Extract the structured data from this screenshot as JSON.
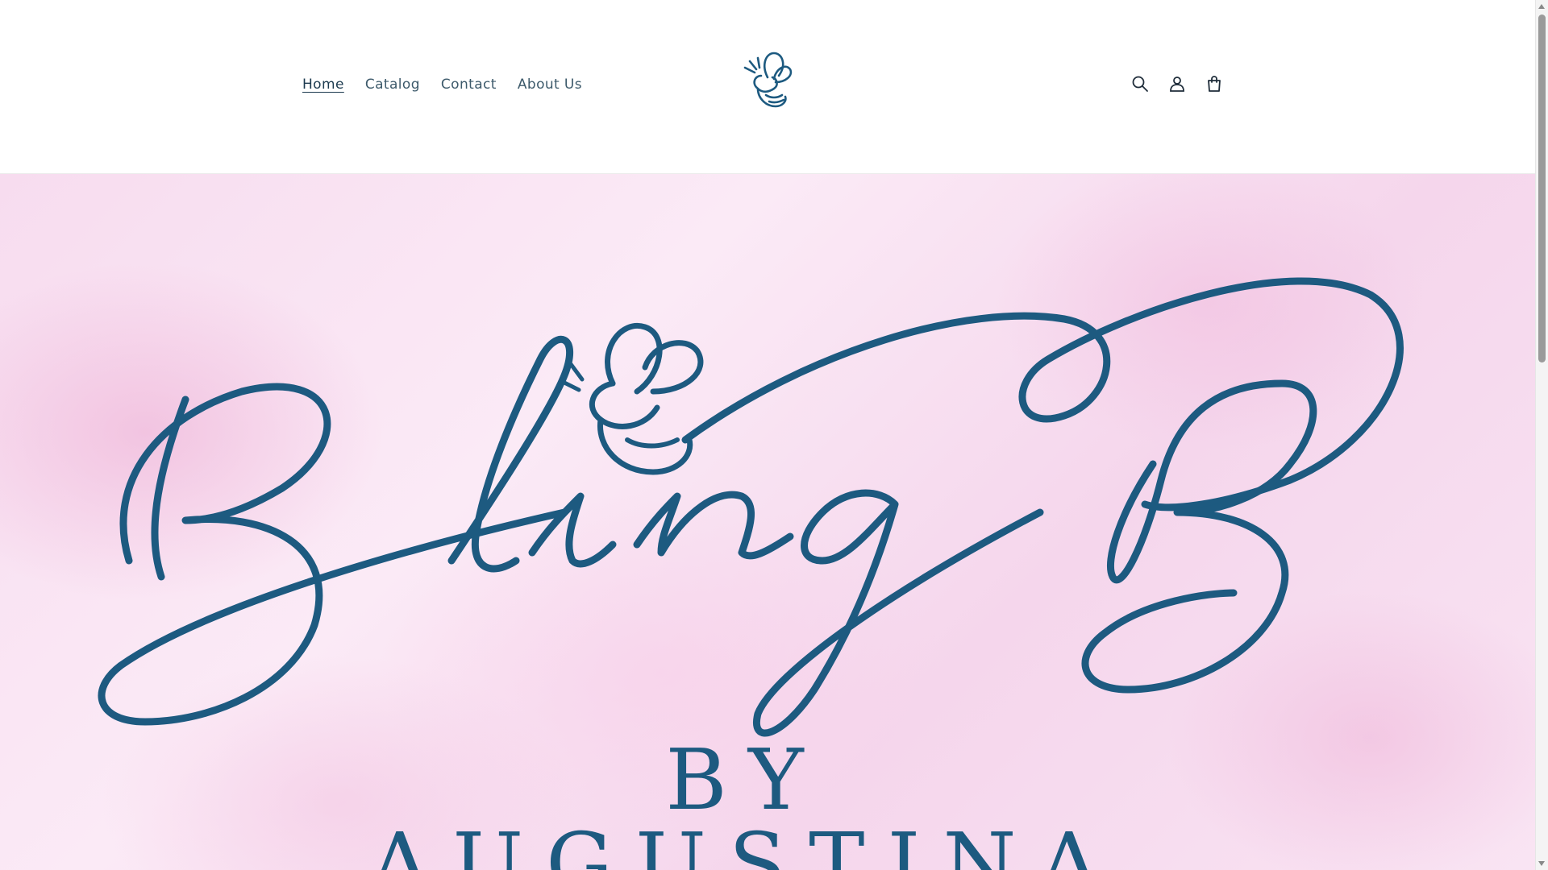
{
  "header": {
    "nav": [
      {
        "label": "Home",
        "active": true
      },
      {
        "label": "Catalog",
        "active": false
      },
      {
        "label": "Contact",
        "active": false
      },
      {
        "label": "About Us",
        "active": false
      }
    ],
    "logo_icon": "bee-logo-icon",
    "icons": [
      "search-icon",
      "account-icon",
      "cart-icon"
    ]
  },
  "hero": {
    "title": "Bling B",
    "subtitle": "BY AUGUSTINA"
  },
  "colors": {
    "brand": "#1d5a80",
    "hero_bg": "#f7dcef",
    "nav_text": "#3d5a6b"
  }
}
